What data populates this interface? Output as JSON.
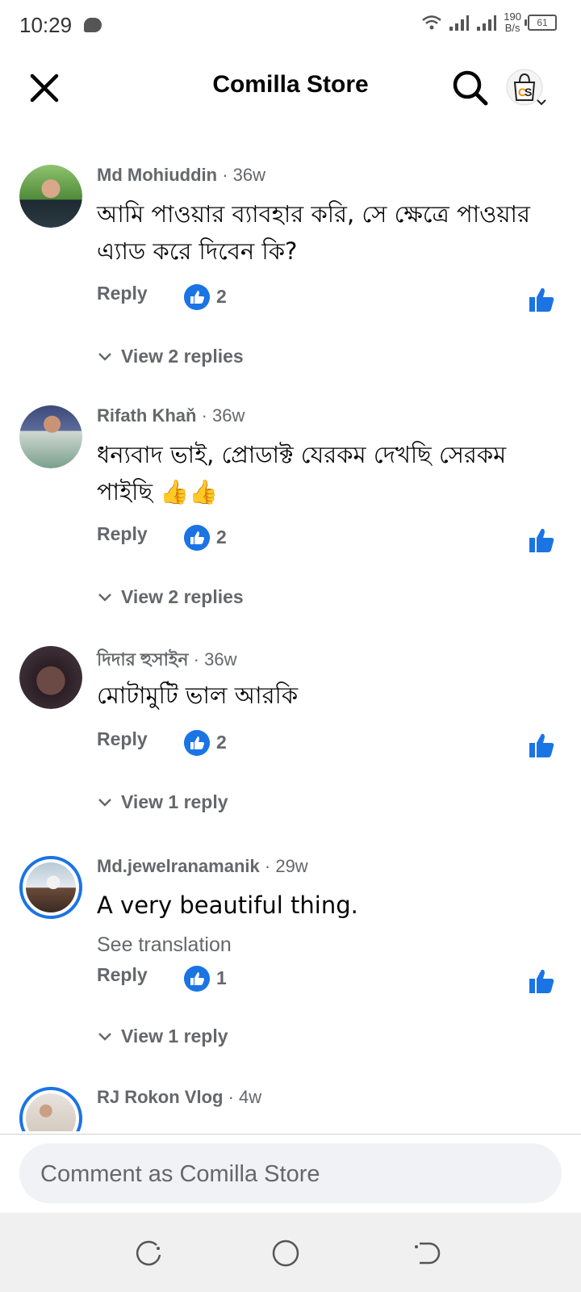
{
  "status_bar": {
    "time": "10:29",
    "net_speed_value": "190",
    "net_speed_unit": "B/s",
    "battery": "61"
  },
  "header": {
    "title": "Comilla Store"
  },
  "comments": [
    {
      "author": "Md Mohiuddin",
      "age": "36w",
      "text": "আমি পাওয়ার ব্যাবহার করি, সে ক্ষেত্রে পাওয়ার এ্যাড করে দিবেন কি?",
      "reply_label": "Reply",
      "like_count": "2",
      "view_replies": "View 2 replies"
    },
    {
      "author": "Rifath Khaň",
      "age": "36w",
      "text": "ধন্যবাদ ভাই, প্রোডাক্ট যেরকম দেখছি সেরকম পাইছি 👍👍",
      "reply_label": "Reply",
      "like_count": "2",
      "view_replies": "View 2 replies"
    },
    {
      "author": "দিদার হুসাইন",
      "age": "36w",
      "text": "মোটামুটি ভাল আরকি",
      "reply_label": "Reply",
      "like_count": "2",
      "view_replies": "View 1 reply"
    },
    {
      "author": "Md.jewelranamanik",
      "age": "29w",
      "text": "A very beautiful thing.",
      "see_translation": "See translation",
      "reply_label": "Reply",
      "like_count": "1",
      "view_replies": "View 1 reply"
    },
    {
      "author": "RJ Rokon Vlog",
      "age": "4w"
    }
  ],
  "comment_box": {
    "placeholder": "Comment as Comilla Store"
  },
  "colors": {
    "accent": "#1b74e4",
    "secondary_text": "#65676b",
    "primary_text": "#050505"
  }
}
